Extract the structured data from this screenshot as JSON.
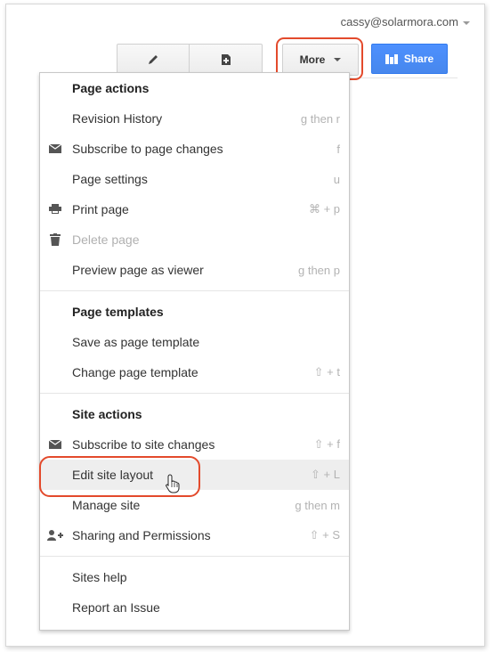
{
  "account": {
    "email": "cassy@solarmora.com"
  },
  "toolbar": {
    "edit_icon": "pencil-icon",
    "new_page_icon": "new-page-icon",
    "more_label": "More",
    "share_label": "Share"
  },
  "menu": {
    "page_actions": {
      "header": "Page actions",
      "revision_history": {
        "label": "Revision History",
        "shortcut": "g then r"
      },
      "subscribe_page": {
        "label": "Subscribe to page changes",
        "shortcut": "f",
        "icon": "envelope-icon"
      },
      "page_settings": {
        "label": "Page settings",
        "shortcut": "u"
      },
      "print_page": {
        "label": "Print page",
        "shortcut": "⌘ + p",
        "icon": "printer-icon"
      },
      "delete_page": {
        "label": "Delete page",
        "shortcut": "",
        "icon": "trash-icon"
      },
      "preview_viewer": {
        "label": "Preview page as viewer",
        "shortcut": "g then p"
      }
    },
    "page_templates": {
      "header": "Page templates",
      "save_template": {
        "label": "Save as page template"
      },
      "change_template": {
        "label": "Change page template",
        "shortcut": "⇧ + t"
      }
    },
    "site_actions": {
      "header": "Site actions",
      "subscribe_site": {
        "label": "Subscribe to site changes",
        "shortcut": "⇧ + f",
        "icon": "envelope-icon"
      },
      "edit_layout": {
        "label": "Edit site layout",
        "shortcut": "⇧ + L"
      },
      "manage_site": {
        "label": "Manage site",
        "shortcut": "g then m"
      },
      "sharing": {
        "label": "Sharing and Permissions",
        "shortcut": "⇧ + S",
        "icon": "add-person-icon"
      }
    },
    "help": {
      "sites_help": {
        "label": "Sites help"
      },
      "report_issue": {
        "label": "Report an Issue"
      }
    }
  },
  "colors": {
    "accent_blue": "#4d90fe",
    "highlight_red": "#e34a2c"
  }
}
